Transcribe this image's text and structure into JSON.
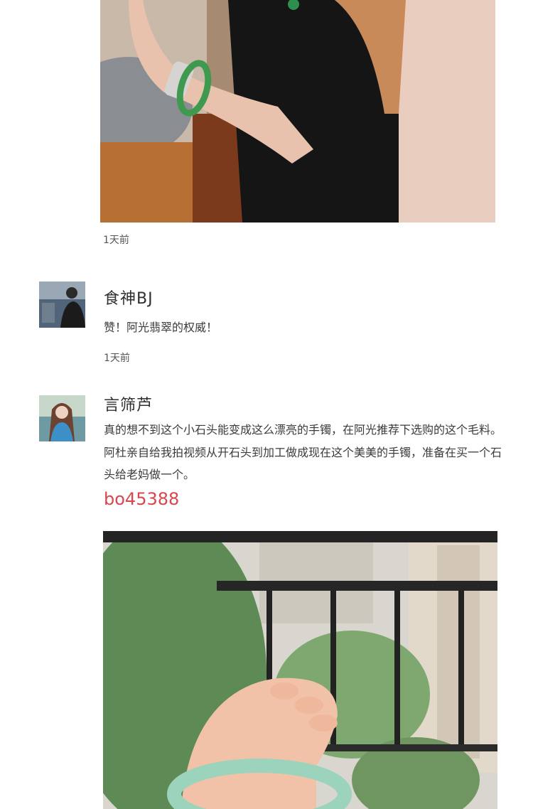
{
  "posts": [
    {
      "time": "1天前"
    },
    {
      "user": "食神BJ",
      "comment": "赞！阿光翡翠的权威！",
      "time": "1天前"
    },
    {
      "user": "言筛芦",
      "comment": "真的想不到这个小石头能变成这么漂亮的手镯，在阿光推荐下选购的这个毛料。阿杜亲自给我拍视频从开石头到加工做成现在这个美美的手镯，准备在买一个石头给老妈做一个。",
      "code": "bo45388"
    }
  ],
  "colors": {
    "code_red": "#d9464d",
    "text": "#3b3b3b"
  }
}
